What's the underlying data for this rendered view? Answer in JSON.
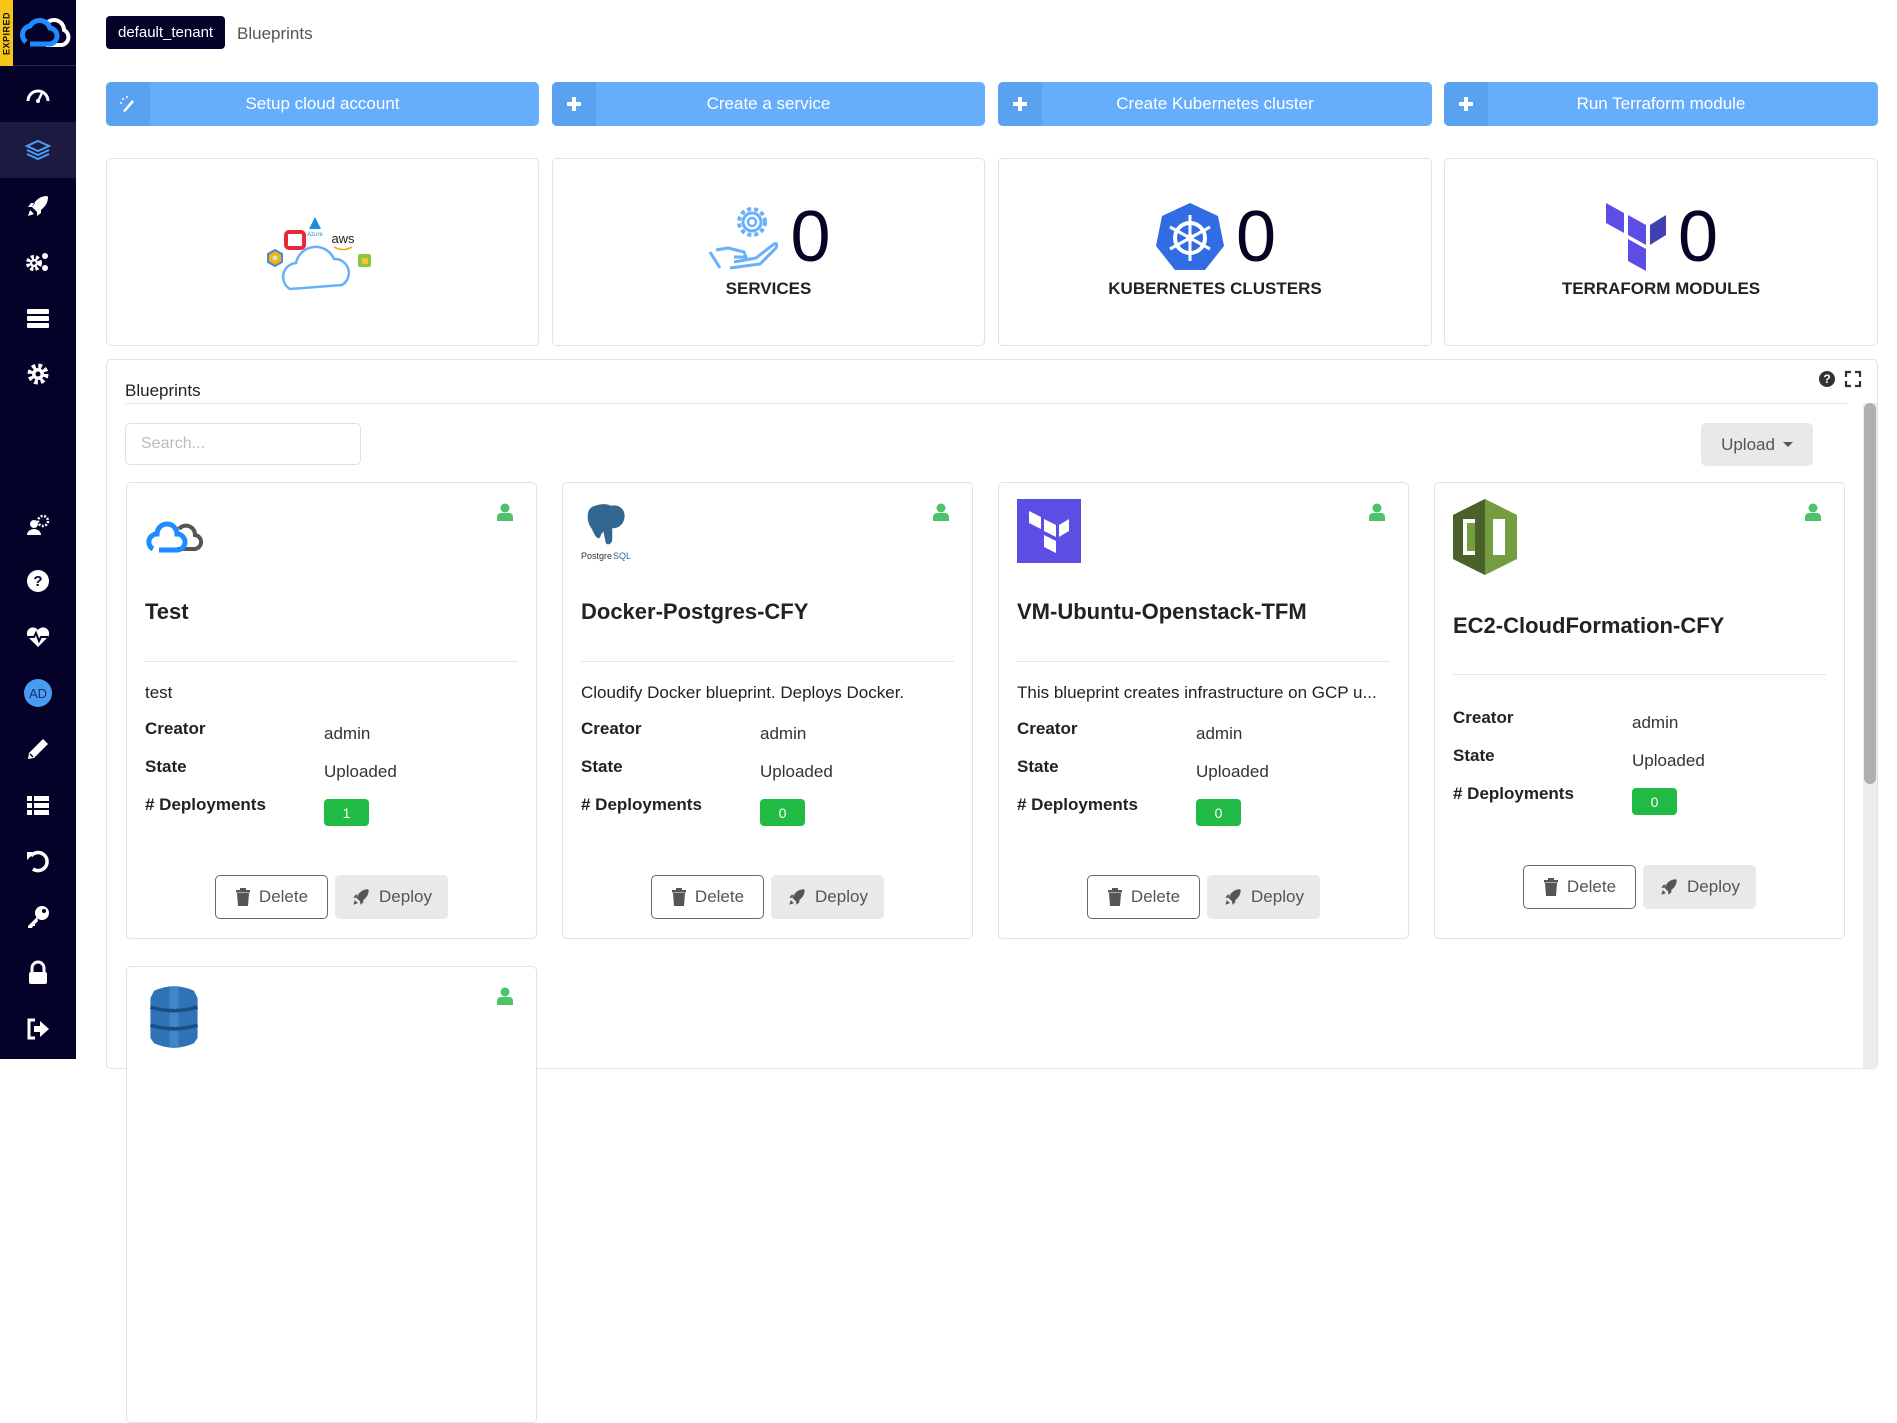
{
  "sidebar": {
    "license_badge": "EXPIRED",
    "avatar_initials": "AD",
    "items": [
      {
        "name": "dashboard",
        "icon": "dashboard-gauge-icon"
      },
      {
        "name": "blueprints",
        "icon": "layers-icon",
        "active": true
      },
      {
        "name": "deployments",
        "icon": "rocket-icon"
      },
      {
        "name": "services",
        "icon": "cogs-icon"
      },
      {
        "name": "resources",
        "icon": "server-icon"
      },
      {
        "name": "settings",
        "icon": "gear-icon"
      },
      {
        "name": "user-settings",
        "icon": "user-cog-icon"
      },
      {
        "name": "help",
        "icon": "question-circle-icon"
      },
      {
        "name": "health",
        "icon": "heartbeat-icon"
      },
      {
        "name": "user-avatar",
        "icon": "avatar"
      },
      {
        "name": "edit-mode",
        "icon": "pencil-icon"
      },
      {
        "name": "list",
        "icon": "list-icon"
      },
      {
        "name": "reset",
        "icon": "undo-icon"
      },
      {
        "name": "license",
        "icon": "key-icon"
      },
      {
        "name": "change-password",
        "icon": "lock-icon"
      },
      {
        "name": "logout",
        "icon": "sign-out-icon"
      }
    ]
  },
  "header": {
    "tenant": "default_tenant",
    "breadcrumb": "Blueprints"
  },
  "actions": [
    {
      "label": "Setup cloud account",
      "icon": "magic-wand-icon"
    },
    {
      "label": "Create a service",
      "icon": "plus-icon"
    },
    {
      "label": "Create Kubernetes cluster",
      "icon": "plus-icon"
    },
    {
      "label": "Run Terraform module",
      "icon": "plus-icon"
    }
  ],
  "stats": [
    {
      "label": "",
      "icon": "cloud-providers-icon"
    },
    {
      "label": "SERVICES",
      "value": "0",
      "icon": "service-hand-gear-icon"
    },
    {
      "label": "KUBERNETES CLUSTERS",
      "value": "0",
      "icon": "kubernetes-icon"
    },
    {
      "label": "TERRAFORM MODULES",
      "value": "0",
      "icon": "terraform-icon"
    }
  ],
  "blueprints_panel": {
    "title": "Blueprints",
    "search_placeholder": "Search...",
    "search_value": "",
    "upload_label": "Upload",
    "field_labels": {
      "creator": "Creator",
      "state": "State",
      "deployments": "# Deployments"
    },
    "delete_label": "Delete",
    "deploy_label": "Deploy",
    "cards": [
      {
        "name": "Test",
        "description": "test",
        "creator": "admin",
        "state": "Uploaded",
        "deployments": "1",
        "icon": "cloudify-logo-icon"
      },
      {
        "name": "Docker-Postgres-CFY",
        "description": "Cloudify Docker blueprint. Deploys Docker.",
        "creator": "admin",
        "state": "Uploaded",
        "deployments": "0",
        "icon": "postgresql-logo-icon"
      },
      {
        "name": "VM-Ubuntu-Openstack-TFM",
        "description": "This blueprint creates infrastructure on GCP u...",
        "creator": "admin",
        "state": "Uploaded",
        "deployments": "0",
        "icon": "terraform-logo-icon"
      },
      {
        "name": "EC2-CloudFormation-CFY",
        "description": "",
        "creator": "admin",
        "state": "Uploaded",
        "deployments": "0",
        "icon": "cloudformation-logo-icon"
      },
      {
        "name": "",
        "description": "",
        "icon": "dynamodb-logo-icon"
      }
    ]
  },
  "colors": {
    "sidebar_bg": "#040228",
    "action_button": "#66adfc",
    "deployments_badge": "#21ba45",
    "visibility_icon": "#4cc36a",
    "expired_badge": "#f5c518"
  }
}
